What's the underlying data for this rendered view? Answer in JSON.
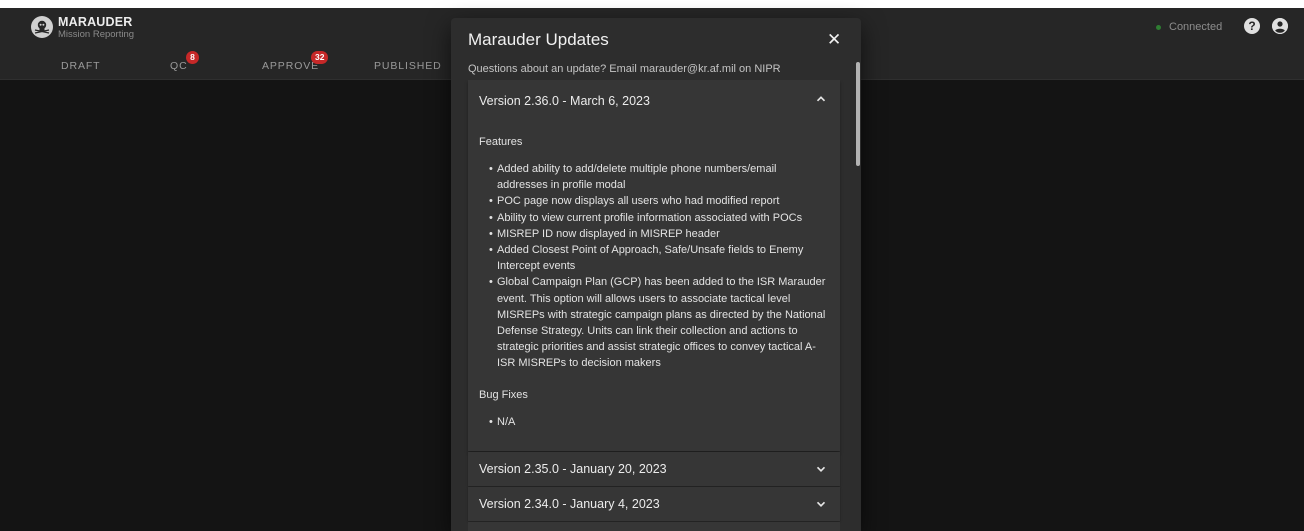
{
  "app": {
    "name": "MARAUDER",
    "subtitle": "Mission Reporting",
    "status_label": "Connected",
    "status_color": "#2e7d32",
    "help_icon": "help-circle-icon",
    "account_icon": "account-circle-icon"
  },
  "nav": {
    "tabs": [
      {
        "label": "DRAFT"
      },
      {
        "label": "QC",
        "badge": "8"
      },
      {
        "label": "APPROVE",
        "badge": "32"
      },
      {
        "label": "PUBLISHED"
      }
    ],
    "badge_color": "#c62828"
  },
  "modal": {
    "title": "Marauder Updates",
    "close_icon": "close-icon",
    "subtitle": "Questions about an update? Email marauder@kr.af.mil on NIPR",
    "versions": [
      {
        "header": "Version 2.36.0 - March 6, 2023",
        "expanded": true,
        "features_title": "Features",
        "features": [
          "Added ability to add/delete multiple phone numbers/email addresses in profile modal",
          "POC page now displays all users who had modified report",
          "Ability to view current profile information associated with POCs",
          "MISREP ID now displayed in MISREP header",
          "Added Closest Point of Approach, Safe/Unsafe fields to Enemy Intercept events",
          "Global Campaign Plan (GCP) has been added to the ISR Marauder event. This option will allows users to associate tactical level MISREPs with strategic campaign plans as directed by the National Defense Strategy. Units can link their collection and actions to strategic priorities and assist strategic offices to convey tactical A-ISR MISREPs to decision makers"
        ],
        "bugfixes_title": "Bug Fixes",
        "bugfixes": [
          "N/A"
        ]
      },
      {
        "header": "Version 2.35.0 - January 20, 2023",
        "expanded": false
      },
      {
        "header": "Version 2.34.0 - January 4, 2023",
        "expanded": false
      }
    ]
  }
}
